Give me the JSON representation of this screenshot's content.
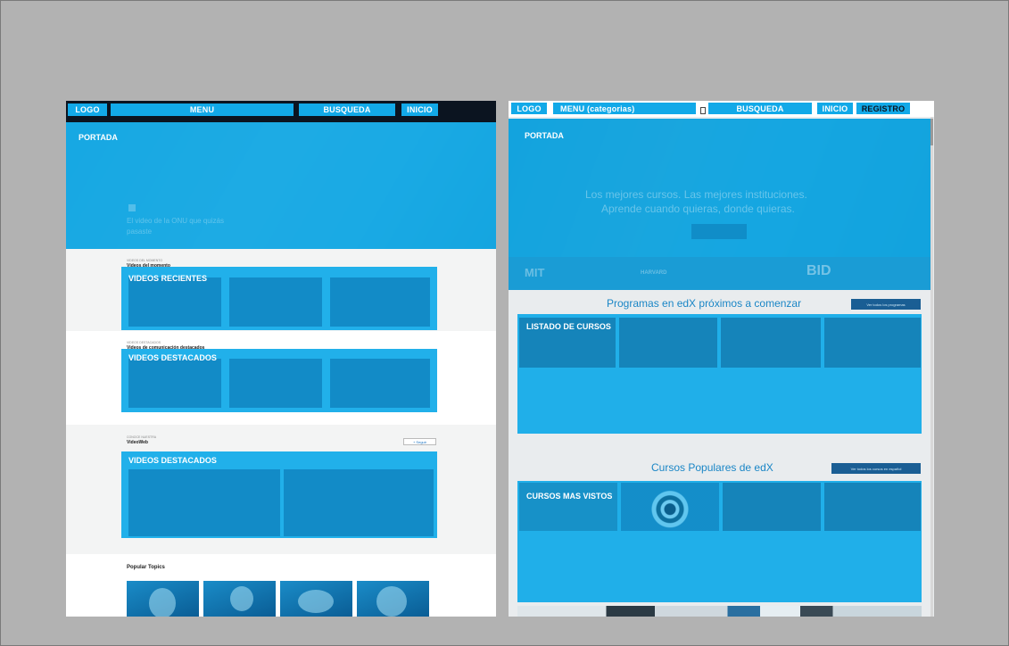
{
  "left": {
    "header": {
      "logo": "LOGO",
      "menu": "MENU",
      "search": "BUSQUEDA",
      "home": "INICIO"
    },
    "hero": {
      "label": "PORTADA",
      "caption_line1": "El video de la ONU que quizás",
      "caption_line2": "pasaste"
    },
    "recent": {
      "kicker": "VIDEOS DEL MOMENTO",
      "title": "Vídeos del momento",
      "label": "VIDEOS RECIENTES"
    },
    "featured1": {
      "kicker": "VIDEOS DESTACADOS",
      "title": "Videos de comunicación destacados",
      "label": "VIDEOS DESTACADOS"
    },
    "featured2": {
      "kicker": "CONOCE NUESTRA",
      "title": "VideoWeb",
      "label": "VIDEOS DESTACADOS",
      "button": "+ Seguir"
    },
    "topics": {
      "title": "Popular Topics"
    }
  },
  "right": {
    "header": {
      "logo": "LOGO",
      "menu": "MENU (categorias)",
      "search": "BUSQUEDA",
      "home": "INICIO",
      "register": "REGISTRO"
    },
    "hero": {
      "label": "PORTADA",
      "headline1": "Los mejores cursos. Las mejores instituciones.",
      "headline2": "Aprende cuando quieras, donde quieras."
    },
    "logos": [
      "MIT",
      "HARVARD",
      "BID"
    ],
    "programs": {
      "heading": "Programas en edX próximos a comenzar",
      "button": "Ver todos los programas",
      "label": "LISTADO DE CURSOS"
    },
    "popular": {
      "heading": "Cursos Populares de edX",
      "button": "Ver todos los cursos en español",
      "label": "CURSOS MAS VISTOS"
    }
  },
  "colors": {
    "accent": "#12a9e8",
    "header_dark": "#0b1420",
    "backdrop": "#b2b2b2"
  }
}
